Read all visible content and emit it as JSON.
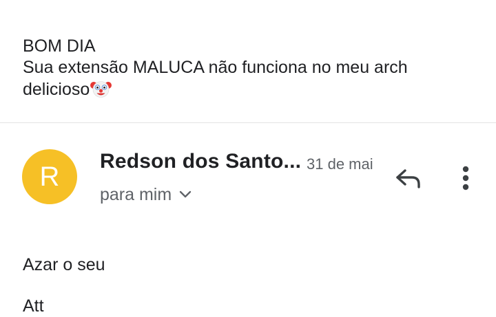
{
  "previous_message": {
    "line1": "BOM DIA",
    "line2": "Sua extensão MALUCA não funciona no meu arch",
    "line3": "delicioso",
    "emoji": "clown-face-emoji"
  },
  "message_header": {
    "avatar_letter": "R",
    "avatar_color": "#f6c026",
    "sender": "Redson dos Santo...",
    "date": "31 de mai",
    "recipient": "para mim",
    "reply_icon": "reply-icon",
    "more_icon": "more-vert-icon"
  },
  "message_body": {
    "line1": "Azar o seu",
    "line2": "Att"
  },
  "colors": {
    "text": "#202124",
    "secondary": "#5f6368",
    "divider": "#e3e3e3"
  }
}
